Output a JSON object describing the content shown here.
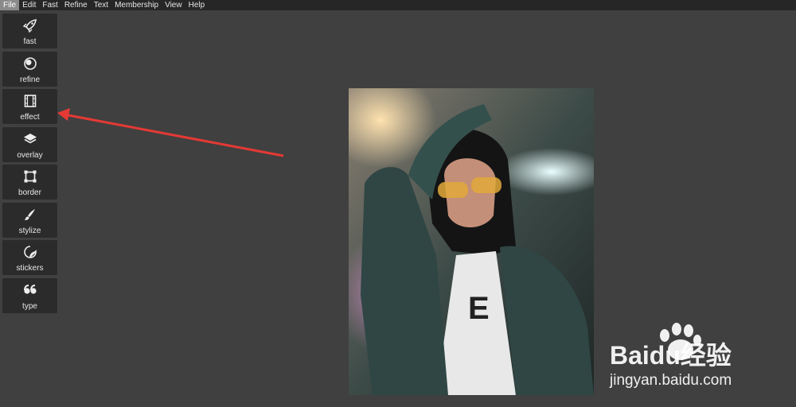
{
  "menu": [
    "File",
    "Edit",
    "Fast",
    "Refine",
    "Text",
    "Membership",
    "View",
    "Help"
  ],
  "tools": [
    {
      "label": "fast",
      "icon": "rocket-icon"
    },
    {
      "label": "refine",
      "icon": "refine-icon"
    },
    {
      "label": "effect",
      "icon": "film-icon"
    },
    {
      "label": "overlay",
      "icon": "layers-icon"
    },
    {
      "label": "border",
      "icon": "border-icon"
    },
    {
      "label": "stylize",
      "icon": "brush-icon"
    },
    {
      "label": "stickers",
      "icon": "sticker-icon"
    },
    {
      "label": "type",
      "icon": "quote-icon"
    }
  ],
  "watermark": {
    "brand": "Baidu经验",
    "url": "jingyan.baidu.com"
  },
  "colors": {
    "background": "#404040",
    "menubar": "#262626",
    "tool_bg": "#2b2b2b",
    "arrow": "#e53935"
  }
}
